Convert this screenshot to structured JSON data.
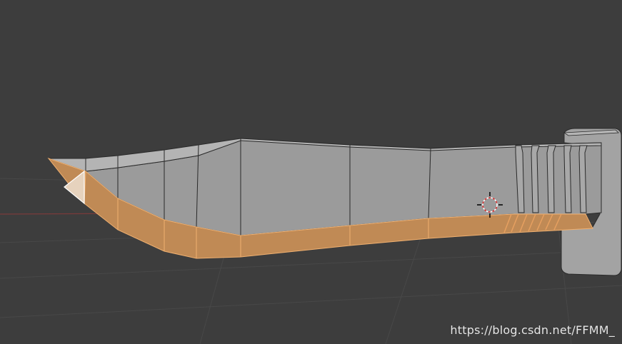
{
  "viewport": {
    "background_color": "#3d3d3d",
    "grid_color": "#4a4a4a",
    "x_axis_color": "#7a3b3b"
  },
  "mesh": {
    "object": "knife",
    "face_color": "#9a9a9a",
    "selected_face_color": "#c08a55",
    "edge_color": "#2a2a2a",
    "selected_edge_color": "#f0b070",
    "active_face_color": "#e8e8e8"
  },
  "cursor_3d": {
    "name": "3d-cursor-icon"
  },
  "watermark": {
    "text": "https://blog.csdn.net/FFMM_"
  }
}
